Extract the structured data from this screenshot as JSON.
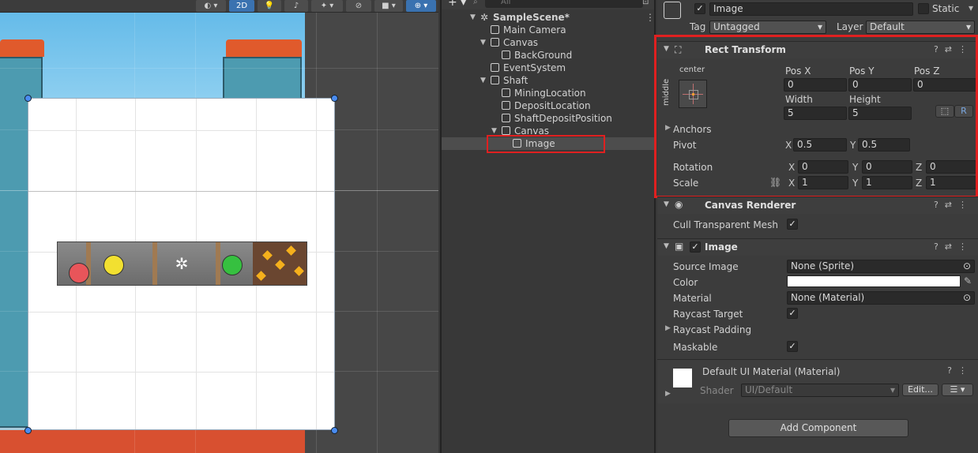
{
  "scene_toolbar": {
    "mode_2d": "2D"
  },
  "hierarchy": {
    "search_placeholder": "All",
    "items": [
      {
        "label": "SampleScene*"
      },
      {
        "label": "Main Camera"
      },
      {
        "label": "Canvas"
      },
      {
        "label": "BackGround"
      },
      {
        "label": "EventSystem"
      },
      {
        "label": "Shaft"
      },
      {
        "label": "MiningLocation"
      },
      {
        "label": "DepositLocation"
      },
      {
        "label": "ShaftDepositPosition"
      },
      {
        "label": "Canvas"
      },
      {
        "label": "Image"
      }
    ]
  },
  "inspector": {
    "object_name": "Image",
    "static_label": "Static",
    "tag_label": "Tag",
    "tag_value": "Untagged",
    "layer_label": "Layer",
    "layer_value": "Default",
    "rect_transform": {
      "title": "Rect Transform",
      "anchor_h": "center",
      "anchor_v": "middle",
      "pos_x_label": "Pos X",
      "pos_x": "0",
      "pos_y_label": "Pos Y",
      "pos_y": "0",
      "pos_z_label": "Pos Z",
      "pos_z": "0",
      "width_label": "Width",
      "width": "5",
      "height_label": "Height",
      "height": "5",
      "r_button": "R",
      "anchors_label": "Anchors",
      "pivot_label": "Pivot",
      "pivot_x": "0.5",
      "pivot_y": "0.5",
      "rotation_label": "Rotation",
      "rot_x": "0",
      "rot_y": "0",
      "rot_z": "0",
      "scale_label": "Scale",
      "scale_x": "1",
      "scale_y": "1",
      "scale_z": "1",
      "axis_x": "X",
      "axis_y": "Y",
      "axis_z": "Z"
    },
    "canvas_renderer": {
      "title": "Canvas Renderer",
      "cull_label": "Cull Transparent Mesh"
    },
    "image": {
      "title": "Image",
      "source_label": "Source Image",
      "source_value": "None (Sprite)",
      "color_label": "Color",
      "material_label": "Material",
      "material_value": "None (Material)",
      "raycast_target_label": "Raycast Target",
      "raycast_padding_label": "Raycast Padding",
      "maskable_label": "Maskable"
    },
    "material_block": {
      "title": "Default UI Material (Material)",
      "shader_label": "Shader",
      "shader_value": "UI/Default",
      "edit_button": "Edit..."
    },
    "add_component": "Add Component"
  }
}
